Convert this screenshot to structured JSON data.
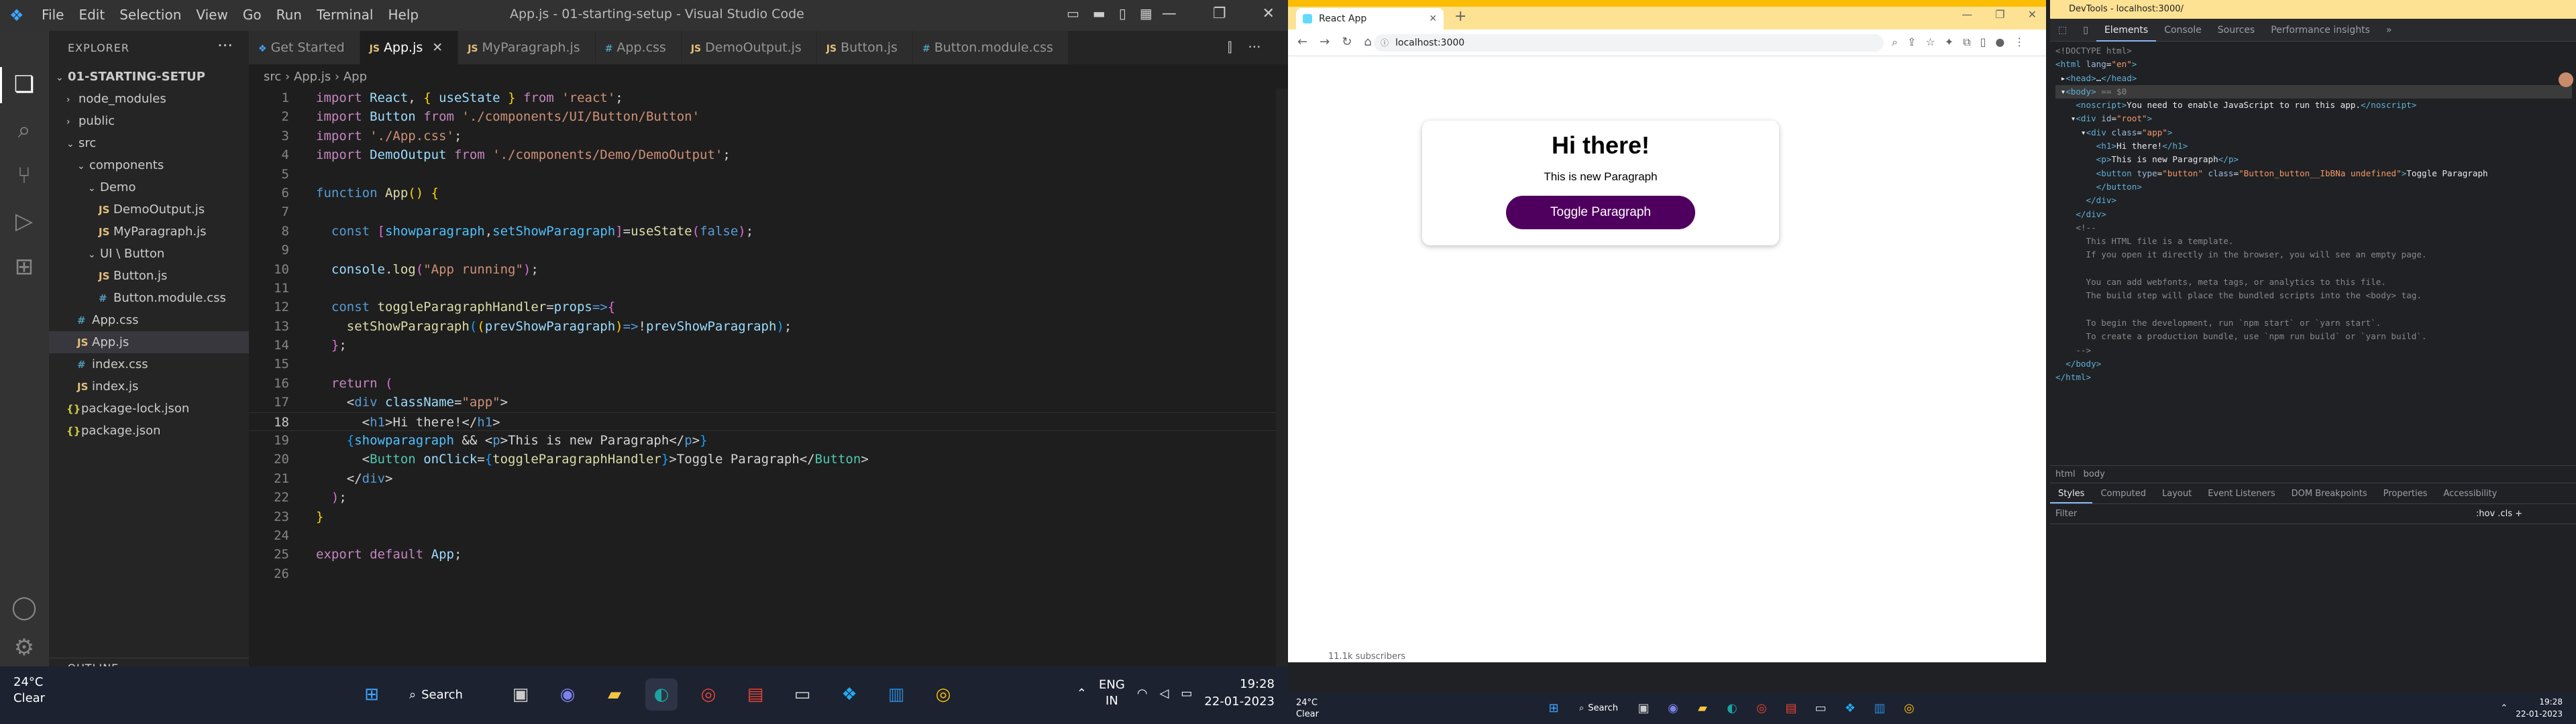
{
  "vscode": {
    "window_title": "App.js - 01-starting-setup - Visual Studio Code",
    "menu": [
      "File",
      "Edit",
      "Selection",
      "View",
      "Go",
      "Run",
      "Terminal",
      "Help"
    ],
    "explorer_label": "EXPLORER",
    "outline_label": "OUTLINE",
    "tree": [
      {
        "label": "01-STARTING-SETUP",
        "depth": 0,
        "kind": "folder-open",
        "bold": true
      },
      {
        "label": "node_modules",
        "depth": 1,
        "kind": "folder"
      },
      {
        "label": "public",
        "depth": 1,
        "kind": "folder"
      },
      {
        "label": "src",
        "depth": 1,
        "kind": "folder-open"
      },
      {
        "label": "components",
        "depth": 2,
        "kind": "folder-open"
      },
      {
        "label": "Demo",
        "depth": 3,
        "kind": "folder-open"
      },
      {
        "label": "DemoOutput.js",
        "depth": 4,
        "kind": "js"
      },
      {
        "label": "MyParagraph.js",
        "depth": 4,
        "kind": "js"
      },
      {
        "label": "UI \\ Button",
        "depth": 3,
        "kind": "folder-open"
      },
      {
        "label": "Button.js",
        "depth": 4,
        "kind": "js"
      },
      {
        "label": "Button.module.css",
        "depth": 4,
        "kind": "css"
      },
      {
        "label": "App.css",
        "depth": 2,
        "kind": "css"
      },
      {
        "label": "App.js",
        "depth": 2,
        "kind": "js",
        "active": true
      },
      {
        "label": "index.css",
        "depth": 2,
        "kind": "css"
      },
      {
        "label": "index.js",
        "depth": 2,
        "kind": "js"
      },
      {
        "label": "package-lock.json",
        "depth": 1,
        "kind": "json"
      },
      {
        "label": "package.json",
        "depth": 1,
        "kind": "json"
      }
    ],
    "tabs": [
      {
        "label": "Get Started",
        "kind": "vs"
      },
      {
        "label": "App.js",
        "kind": "js",
        "active": true
      },
      {
        "label": "MyParagraph.js",
        "kind": "js"
      },
      {
        "label": "App.css",
        "kind": "css"
      },
      {
        "label": "DemoOutput.js",
        "kind": "js"
      },
      {
        "label": "Button.js",
        "kind": "js"
      },
      {
        "label": "Button.module.css",
        "kind": "css"
      }
    ],
    "breadcrumb": [
      "src",
      "App.js",
      "App"
    ],
    "current_line": 18
  },
  "taskbar_left": {
    "weather_temp": "24°C",
    "weather_cond": "Clear",
    "search_label": "Search",
    "lang": "ENG",
    "region": "IN",
    "time": "19:28",
    "date": "22-01-2023"
  },
  "chrome": {
    "tab_title": "React App",
    "url": "localhost:3000",
    "page": {
      "heading": "Hi there!",
      "paragraph": "This is new Paragraph",
      "button": "Toggle Paragraph"
    },
    "bottom_hint": "11.1k subscribers"
  },
  "devtools": {
    "title": "DevTools - localhost:3000/",
    "tabs": [
      "Elements",
      "Console",
      "Sources",
      "Performance insights",
      "»"
    ],
    "active_tab": "Elements",
    "crumbs": [
      "html",
      "body"
    ],
    "subtabs": [
      "Styles",
      "Computed",
      "Layout",
      "Event Listeners",
      "DOM Breakpoints",
      "Properties",
      "Accessibility"
    ],
    "active_subtab": "Styles",
    "filter_placeholder": "Filter",
    "filter_tools": ":hov  .cls  +"
  },
  "taskbar_right": {
    "weather_temp": "24°C",
    "weather_cond": "Clear",
    "search_label": "Search",
    "time": "19:28",
    "date": "22-01-2023"
  }
}
